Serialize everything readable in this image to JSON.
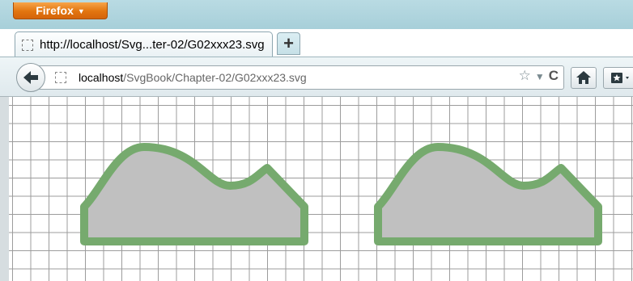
{
  "browser": {
    "menu_button_label": "Firefox",
    "tab_title": "http://localhost/Svg...ter-02/G02xxx23.svg",
    "new_tab_label": "+",
    "url_host": "localhost",
    "url_path": "/SvgBook/Chapter-02/G02xxx23.svg"
  },
  "icons": {
    "back": "arrow-left-icon",
    "site": "page-icon",
    "bookmark_star": "star-icon",
    "history_dropdown": "triangle-down-icon",
    "reload": "reload-icon",
    "home": "home-icon",
    "bookmarks": "bookmarks-icon"
  },
  "canvas": {
    "grid_color": "#9c9c9c",
    "shape_fill": "#c0c0c0",
    "shape_stroke": "#76aa6e"
  }
}
